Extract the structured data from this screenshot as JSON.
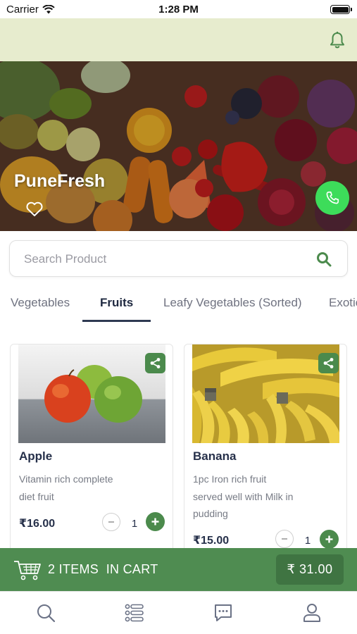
{
  "status_bar": {
    "carrier": "Carrier",
    "time": "1:28 PM"
  },
  "hero": {
    "title": "PuneFresh"
  },
  "search": {
    "placeholder": "Search Product"
  },
  "tabs": [
    {
      "label": "Vegetables",
      "active": false
    },
    {
      "label": "Fruits",
      "active": true
    },
    {
      "label": "Leafy Vegetables (Sorted)",
      "active": false
    },
    {
      "label": "Exotic",
      "active": false
    }
  ],
  "products": [
    {
      "name": "Apple",
      "description": [
        "Vitamin rich complete",
        "diet fruit"
      ],
      "price": "₹16.00",
      "quantity": "1"
    },
    {
      "name": "Banana",
      "description": [
        "1pc Iron rich fruit",
        "served well with Milk in",
        "pudding"
      ],
      "price": "₹15.00",
      "quantity": "1"
    }
  ],
  "cart": {
    "summary": "2 ITEMS  IN CART",
    "total": "₹ 31.00"
  },
  "bottom_nav": [
    "search-icon",
    "list-icon",
    "chat-icon",
    "profile-icon"
  ],
  "colors": {
    "header_bg": "#e7ecce",
    "accent_green": "#4f8c51",
    "call_green": "#3ddc5a"
  }
}
